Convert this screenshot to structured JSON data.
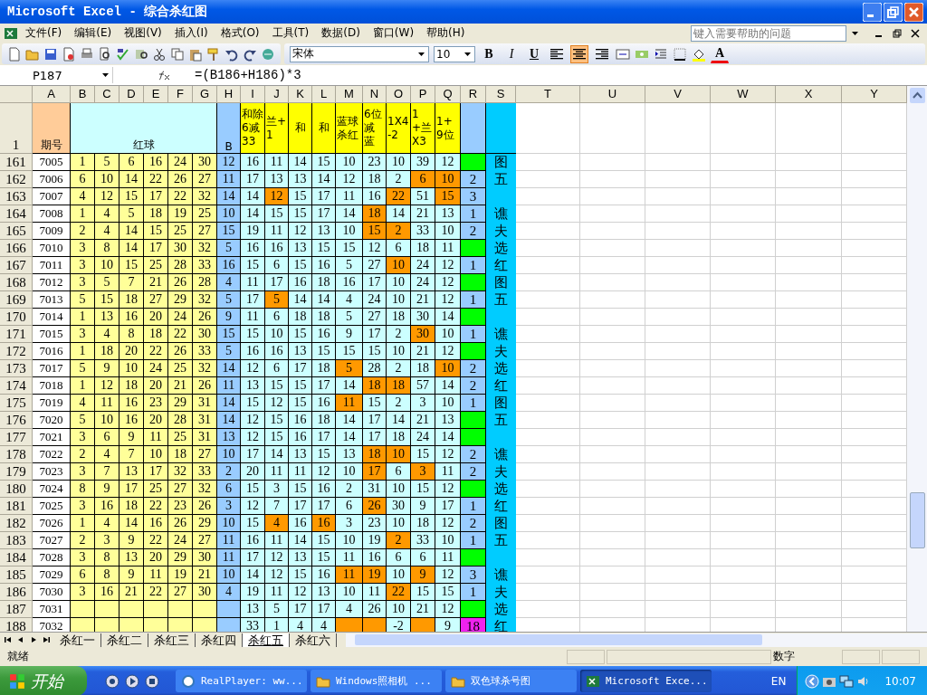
{
  "window": {
    "title": "Microsoft Excel - 综合杀红图"
  },
  "menu": [
    "文件(F)",
    "编辑(E)",
    "视图(V)",
    "插入(I)",
    "格式(O)",
    "工具(T)",
    "数据(D)",
    "窗口(W)",
    "帮助(H)"
  ],
  "help_box": {
    "placeholder": "键入需要帮助的问题"
  },
  "toolbar": {
    "font": "宋体",
    "size": "10",
    "bold": "B",
    "italic": "I",
    "underline": "U",
    "font_color": "A",
    "align_buttons": [
      {
        "kind": "left",
        "selected": false
      },
      {
        "kind": "center",
        "selected": true
      },
      {
        "kind": "right",
        "selected": false
      }
    ]
  },
  "formula_bar": {
    "cell": "P187",
    "formula": "=(B186+H186)*3"
  },
  "columns": [
    "A",
    "B",
    "C",
    "D",
    "E",
    "F",
    "G",
    "H",
    "I",
    "J",
    "K",
    "L",
    "M",
    "N",
    "O",
    "P",
    "Q",
    "R",
    "S",
    "T",
    "U",
    "V",
    "W",
    "X",
    "Y"
  ],
  "header_row": {
    "number": "1",
    "issue": "期号",
    "red": "红球",
    "b": "B",
    "calc": [
      "和除6减33",
      "兰+1",
      "和",
      "和",
      "蓝球杀红",
      "6位减蓝",
      "1X4-2",
      "1+兰X3",
      "1+9位"
    ]
  },
  "rows": [
    {
      "number": "161",
      "issue": "7005",
      "red": [
        "1",
        "5",
        "6",
        "16",
        "24",
        "30"
      ],
      "b": "12",
      "calc": [
        {
          "text": "16",
          "highlighted": false
        },
        {
          "text": "11",
          "highlighted": false
        },
        {
          "text": "14",
          "highlighted": false
        },
        {
          "text": "15",
          "highlighted": false
        },
        {
          "text": "10",
          "highlighted": false
        },
        {
          "text": "23",
          "highlighted": false
        },
        {
          "text": "10",
          "highlighted": false
        },
        {
          "text": "39",
          "highlighted": false
        },
        {
          "text": "12",
          "highlighted": false
        }
      ],
      "r": {
        "color": "#00ff00"
      },
      "s": "图"
    },
    {
      "number": "162",
      "issue": "7006",
      "red": [
        "6",
        "10",
        "14",
        "22",
        "26",
        "27"
      ],
      "b": "11",
      "calc": [
        {
          "text": "17",
          "highlighted": false
        },
        {
          "text": "13",
          "highlighted": false
        },
        {
          "text": "13",
          "highlighted": false
        },
        {
          "text": "14",
          "highlighted": false
        },
        {
          "text": "12",
          "highlighted": false
        },
        {
          "text": "18",
          "highlighted": false
        },
        {
          "text": "2",
          "highlighted": false
        },
        {
          "text": "6",
          "highlighted": true
        },
        {
          "text": "10",
          "highlighted": true
        }
      ],
      "r": {
        "text": "2",
        "color": "#99ccff"
      },
      "s": "五"
    },
    {
      "number": "163",
      "issue": "7007",
      "red": [
        "4",
        "12",
        "15",
        "17",
        "22",
        "32"
      ],
      "b": "14",
      "calc": [
        {
          "text": "14",
          "highlighted": false
        },
        {
          "text": "12",
          "highlighted": true
        },
        {
          "text": "15",
          "highlighted": false
        },
        {
          "text": "17",
          "highlighted": false
        },
        {
          "text": "11",
          "highlighted": false
        },
        {
          "text": "16",
          "highlighted": false
        },
        {
          "text": "22",
          "highlighted": true
        },
        {
          "text": "51",
          "highlighted": false
        },
        {
          "text": "15",
          "highlighted": true
        }
      ],
      "r": {
        "text": "3",
        "color": "#99ccff"
      }
    },
    {
      "number": "164",
      "issue": "7008",
      "red": [
        "1",
        "4",
        "5",
        "18",
        "19",
        "25"
      ],
      "b": "10",
      "calc": [
        {
          "text": "14",
          "highlighted": false
        },
        {
          "text": "15",
          "highlighted": false
        },
        {
          "text": "15",
          "highlighted": false
        },
        {
          "text": "17",
          "highlighted": false
        },
        {
          "text": "14",
          "highlighted": false
        },
        {
          "text": "18",
          "highlighted": true
        },
        {
          "text": "14",
          "highlighted": false
        },
        {
          "text": "21",
          "highlighted": false
        },
        {
          "text": "13",
          "highlighted": false
        }
      ],
      "r": {
        "text": "1",
        "color": "#99ccff"
      },
      "s": "谯"
    },
    {
      "number": "165",
      "issue": "7009",
      "red": [
        "2",
        "4",
        "14",
        "15",
        "25",
        "27"
      ],
      "b": "15",
      "calc": [
        {
          "text": "19",
          "highlighted": false
        },
        {
          "text": "11",
          "highlighted": false
        },
        {
          "text": "12",
          "highlighted": false
        },
        {
          "text": "13",
          "highlighted": false
        },
        {
          "text": "10",
          "highlighted": false
        },
        {
          "text": "15",
          "highlighted": true
        },
        {
          "text": "2",
          "highlighted": true
        },
        {
          "text": "33",
          "highlighted": false
        },
        {
          "text": "10",
          "highlighted": false
        }
      ],
      "r": {
        "text": "2",
        "color": "#99ccff"
      },
      "s": "夫"
    },
    {
      "number": "166",
      "issue": "7010",
      "red": [
        "3",
        "8",
        "14",
        "17",
        "30",
        "32"
      ],
      "b": "5",
      "calc": [
        {
          "text": "16",
          "highlighted": false
        },
        {
          "text": "16",
          "highlighted": false
        },
        {
          "text": "13",
          "highlighted": false
        },
        {
          "text": "15",
          "highlighted": false
        },
        {
          "text": "15",
          "highlighted": false
        },
        {
          "text": "12",
          "highlighted": false
        },
        {
          "text": "6",
          "highlighted": false
        },
        {
          "text": "18",
          "highlighted": false
        },
        {
          "text": "11",
          "highlighted": false
        }
      ],
      "r": {
        "color": "#00ff00"
      },
      "s": "选"
    },
    {
      "number": "167",
      "issue": "7011",
      "red": [
        "3",
        "10",
        "15",
        "25",
        "28",
        "33"
      ],
      "b": "16",
      "calc": [
        {
          "text": "15",
          "highlighted": false
        },
        {
          "text": "6",
          "highlighted": false
        },
        {
          "text": "15",
          "highlighted": false
        },
        {
          "text": "16",
          "highlighted": false
        },
        {
          "text": "5",
          "highlighted": false
        },
        {
          "text": "27",
          "highlighted": false
        },
        {
          "text": "10",
          "highlighted": true
        },
        {
          "text": "24",
          "highlighted": false
        },
        {
          "text": "12",
          "highlighted": false
        }
      ],
      "r": {
        "text": "1",
        "color": "#99ccff"
      },
      "s": "红"
    },
    {
      "number": "168",
      "issue": "7012",
      "red": [
        "3",
        "5",
        "7",
        "21",
        "26",
        "28"
      ],
      "b": "4",
      "calc": [
        {
          "text": "11",
          "highlighted": false
        },
        {
          "text": "17",
          "highlighted": false
        },
        {
          "text": "16",
          "highlighted": false
        },
        {
          "text": "18",
          "highlighted": false
        },
        {
          "text": "16",
          "highlighted": false
        },
        {
          "text": "17",
          "highlighted": false
        },
        {
          "text": "10",
          "highlighted": false
        },
        {
          "text": "24",
          "highlighted": false
        },
        {
          "text": "12",
          "highlighted": false
        }
      ],
      "r": {
        "color": "#00ff00"
      },
      "s": "图"
    },
    {
      "number": "169",
      "issue": "7013",
      "red": [
        "5",
        "15",
        "18",
        "27",
        "29",
        "32"
      ],
      "b": "5",
      "calc": [
        {
          "text": "17",
          "highlighted": false
        },
        {
          "text": "5",
          "highlighted": true
        },
        {
          "text": "14",
          "highlighted": false
        },
        {
          "text": "14",
          "highlighted": false
        },
        {
          "text": "4",
          "highlighted": false
        },
        {
          "text": "24",
          "highlighted": false
        },
        {
          "text": "10",
          "highlighted": false
        },
        {
          "text": "21",
          "highlighted": false
        },
        {
          "text": "12",
          "highlighted": false
        }
      ],
      "r": {
        "text": "1",
        "color": "#99ccff"
      },
      "s": "五"
    },
    {
      "number": "170",
      "issue": "7014",
      "red": [
        "1",
        "13",
        "16",
        "20",
        "24",
        "26"
      ],
      "b": "9",
      "calc": [
        {
          "text": "11",
          "highlighted": false
        },
        {
          "text": "6",
          "highlighted": false
        },
        {
          "text": "18",
          "highlighted": false
        },
        {
          "text": "18",
          "highlighted": false
        },
        {
          "text": "5",
          "highlighted": false
        },
        {
          "text": "27",
          "highlighted": false
        },
        {
          "text": "18",
          "highlighted": false
        },
        {
          "text": "30",
          "highlighted": false
        },
        {
          "text": "14",
          "highlighted": false
        }
      ],
      "r": {
        "color": "#00ff00"
      }
    },
    {
      "number": "171",
      "issue": "7015",
      "red": [
        "3",
        "4",
        "8",
        "18",
        "22",
        "30"
      ],
      "b": "15",
      "calc": [
        {
          "text": "15",
          "highlighted": false
        },
        {
          "text": "10",
          "highlighted": false
        },
        {
          "text": "15",
          "highlighted": false
        },
        {
          "text": "16",
          "highlighted": false
        },
        {
          "text": "9",
          "highlighted": false
        },
        {
          "text": "17",
          "highlighted": false
        },
        {
          "text": "2",
          "highlighted": false
        },
        {
          "text": "30",
          "highlighted": true
        },
        {
          "text": "10",
          "highlighted": false
        }
      ],
      "r": {
        "text": "1",
        "color": "#99ccff"
      },
      "s": "谯"
    },
    {
      "number": "172",
      "issue": "7016",
      "red": [
        "1",
        "18",
        "20",
        "22",
        "26",
        "33"
      ],
      "b": "5",
      "calc": [
        {
          "text": "16",
          "highlighted": false
        },
        {
          "text": "16",
          "highlighted": false
        },
        {
          "text": "13",
          "highlighted": false
        },
        {
          "text": "15",
          "highlighted": false
        },
        {
          "text": "15",
          "highlighted": false
        },
        {
          "text": "15",
          "highlighted": false
        },
        {
          "text": "10",
          "highlighted": false
        },
        {
          "text": "21",
          "highlighted": false
        },
        {
          "text": "12",
          "highlighted": false
        }
      ],
      "r": {
        "color": "#00ff00"
      },
      "s": "夫"
    },
    {
      "number": "173",
      "issue": "7017",
      "red": [
        "5",
        "9",
        "10",
        "24",
        "25",
        "32"
      ],
      "b": "14",
      "calc": [
        {
          "text": "12",
          "highlighted": false
        },
        {
          "text": "6",
          "highlighted": false
        },
        {
          "text": "17",
          "highlighted": false
        },
        {
          "text": "18",
          "highlighted": false
        },
        {
          "text": "5",
          "highlighted": true
        },
        {
          "text": "28",
          "highlighted": false
        },
        {
          "text": "2",
          "highlighted": false
        },
        {
          "text": "18",
          "highlighted": false
        },
        {
          "text": "10",
          "highlighted": true
        }
      ],
      "r": {
        "text": "2",
        "color": "#99ccff"
      },
      "s": "选"
    },
    {
      "number": "174",
      "issue": "7018",
      "red": [
        "1",
        "12",
        "18",
        "20",
        "21",
        "26"
      ],
      "b": "11",
      "calc": [
        {
          "text": "13",
          "highlighted": false
        },
        {
          "text": "15",
          "highlighted": false
        },
        {
          "text": "15",
          "highlighted": false
        },
        {
          "text": "17",
          "highlighted": false
        },
        {
          "text": "14",
          "highlighted": false
        },
        {
          "text": "18",
          "highlighted": true
        },
        {
          "text": "18",
          "highlighted": true
        },
        {
          "text": "57",
          "highlighted": false
        },
        {
          "text": "14",
          "highlighted": false
        }
      ],
      "r": {
        "text": "2",
        "color": "#99ccff"
      },
      "s": "红"
    },
    {
      "number": "175",
      "issue": "7019",
      "red": [
        "4",
        "11",
        "16",
        "23",
        "29",
        "31"
      ],
      "b": "14",
      "calc": [
        {
          "text": "15",
          "highlighted": false
        },
        {
          "text": "12",
          "highlighted": false
        },
        {
          "text": "15",
          "highlighted": false
        },
        {
          "text": "16",
          "highlighted": false
        },
        {
          "text": "11",
          "highlighted": true
        },
        {
          "text": "15",
          "highlighted": false
        },
        {
          "text": "2",
          "highlighted": false
        },
        {
          "text": "3",
          "highlighted": false
        },
        {
          "text": "10",
          "highlighted": false
        }
      ],
      "r": {
        "text": "1",
        "color": "#99ccff"
      },
      "s": "图"
    },
    {
      "number": "176",
      "issue": "7020",
      "red": [
        "5",
        "10",
        "16",
        "20",
        "28",
        "31"
      ],
      "b": "14",
      "calc": [
        {
          "text": "12",
          "highlighted": false
        },
        {
          "text": "15",
          "highlighted": false
        },
        {
          "text": "16",
          "highlighted": false
        },
        {
          "text": "18",
          "highlighted": false
        },
        {
          "text": "14",
          "highlighted": false
        },
        {
          "text": "17",
          "highlighted": false
        },
        {
          "text": "14",
          "highlighted": false
        },
        {
          "text": "21",
          "highlighted": false
        },
        {
          "text": "13",
          "highlighted": false
        }
      ],
      "r": {
        "color": "#00ff00"
      },
      "s": "五"
    },
    {
      "number": "177",
      "issue": "7021",
      "red": [
        "3",
        "6",
        "9",
        "11",
        "25",
        "31"
      ],
      "b": "13",
      "calc": [
        {
          "text": "12",
          "highlighted": false
        },
        {
          "text": "15",
          "highlighted": false
        },
        {
          "text": "16",
          "highlighted": false
        },
        {
          "text": "17",
          "highlighted": false
        },
        {
          "text": "14",
          "highlighted": false
        },
        {
          "text": "17",
          "highlighted": false
        },
        {
          "text": "18",
          "highlighted": false
        },
        {
          "text": "24",
          "highlighted": false
        },
        {
          "text": "14",
          "highlighted": false
        }
      ],
      "r": {
        "color": "#00ff00"
      }
    },
    {
      "number": "178",
      "issue": "7022",
      "red": [
        "2",
        "4",
        "7",
        "10",
        "18",
        "27"
      ],
      "b": "10",
      "calc": [
        {
          "text": "17",
          "highlighted": false
        },
        {
          "text": "14",
          "highlighted": false
        },
        {
          "text": "13",
          "highlighted": false
        },
        {
          "text": "15",
          "highlighted": false
        },
        {
          "text": "13",
          "highlighted": false
        },
        {
          "text": "18",
          "highlighted": true
        },
        {
          "text": "10",
          "highlighted": true
        },
        {
          "text": "15",
          "highlighted": false
        },
        {
          "text": "12",
          "highlighted": false
        }
      ],
      "r": {
        "text": "2",
        "color": "#99ccff"
      },
      "s": "谯"
    },
    {
      "number": "179",
      "issue": "7023",
      "red": [
        "3",
        "7",
        "13",
        "17",
        "32",
        "33"
      ],
      "b": "2",
      "calc": [
        {
          "text": "20",
          "highlighted": false
        },
        {
          "text": "11",
          "highlighted": false
        },
        {
          "text": "11",
          "highlighted": false
        },
        {
          "text": "12",
          "highlighted": false
        },
        {
          "text": "10",
          "highlighted": false
        },
        {
          "text": "17",
          "highlighted": true
        },
        {
          "text": "6",
          "highlighted": false
        },
        {
          "text": "3",
          "highlighted": true
        },
        {
          "text": "11",
          "highlighted": false
        }
      ],
      "r": {
        "text": "2",
        "color": "#99ccff"
      },
      "s": "夫"
    },
    {
      "number": "180",
      "issue": "7024",
      "red": [
        "8",
        "9",
        "17",
        "25",
        "27",
        "32"
      ],
      "b": "6",
      "calc": [
        {
          "text": "15",
          "highlighted": false
        },
        {
          "text": "3",
          "highlighted": false
        },
        {
          "text": "15",
          "highlighted": false
        },
        {
          "text": "16",
          "highlighted": false
        },
        {
          "text": "2",
          "highlighted": false
        },
        {
          "text": "31",
          "highlighted": false
        },
        {
          "text": "10",
          "highlighted": false
        },
        {
          "text": "15",
          "highlighted": false
        },
        {
          "text": "12",
          "highlighted": false
        }
      ],
      "r": {
        "color": "#00ff00"
      },
      "s": "选"
    },
    {
      "number": "181",
      "issue": "7025",
      "red": [
        "3",
        "16",
        "18",
        "22",
        "23",
        "26"
      ],
      "b": "3",
      "calc": [
        {
          "text": "12",
          "highlighted": false
        },
        {
          "text": "7",
          "highlighted": false
        },
        {
          "text": "17",
          "highlighted": false
        },
        {
          "text": "17",
          "highlighted": false
        },
        {
          "text": "6",
          "highlighted": false
        },
        {
          "text": "26",
          "highlighted": true
        },
        {
          "text": "30",
          "highlighted": false
        },
        {
          "text": "9",
          "highlighted": false
        },
        {
          "text": "17",
          "highlighted": false
        }
      ],
      "r": {
        "text": "1",
        "color": "#99ccff"
      },
      "s": "红"
    },
    {
      "number": "182",
      "issue": "7026",
      "red": [
        "1",
        "4",
        "14",
        "16",
        "26",
        "29"
      ],
      "b": "10",
      "calc": [
        {
          "text": "15",
          "highlighted": false
        },
        {
          "text": "4",
          "highlighted": true
        },
        {
          "text": "16",
          "highlighted": false
        },
        {
          "text": "16",
          "highlighted": true
        },
        {
          "text": "3",
          "highlighted": false
        },
        {
          "text": "23",
          "highlighted": false
        },
        {
          "text": "10",
          "highlighted": false
        },
        {
          "text": "18",
          "highlighted": false
        },
        {
          "text": "12",
          "highlighted": false
        }
      ],
      "r": {
        "text": "2",
        "color": "#99ccff"
      },
      "s": "图"
    },
    {
      "number": "183",
      "issue": "7027",
      "red": [
        "2",
        "3",
        "9",
        "22",
        "24",
        "27"
      ],
      "b": "11",
      "calc": [
        {
          "text": "16",
          "highlighted": false
        },
        {
          "text": "11",
          "highlighted": false
        },
        {
          "text": "14",
          "highlighted": false
        },
        {
          "text": "15",
          "highlighted": false
        },
        {
          "text": "10",
          "highlighted": false
        },
        {
          "text": "19",
          "highlighted": false
        },
        {
          "text": "2",
          "highlighted": true
        },
        {
          "text": "33",
          "highlighted": false
        },
        {
          "text": "10",
          "highlighted": false
        }
      ],
      "r": {
        "text": "1",
        "color": "#99ccff"
      },
      "s": "五"
    },
    {
      "number": "184",
      "issue": "7028",
      "red": [
        "3",
        "8",
        "13",
        "20",
        "29",
        "30"
      ],
      "b": "11",
      "calc": [
        {
          "text": "17",
          "highlighted": false
        },
        {
          "text": "12",
          "highlighted": false
        },
        {
          "text": "13",
          "highlighted": false
        },
        {
          "text": "15",
          "highlighted": false
        },
        {
          "text": "11",
          "highlighted": false
        },
        {
          "text": "16",
          "highlighted": false
        },
        {
          "text": "6",
          "highlighted": false
        },
        {
          "text": "6",
          "highlighted": false
        },
        {
          "text": "11",
          "highlighted": false
        }
      ],
      "r": {
        "color": "#00ff00"
      }
    },
    {
      "number": "185",
      "issue": "7029",
      "red": [
        "6",
        "8",
        "9",
        "11",
        "19",
        "21"
      ],
      "b": "10",
      "calc": [
        {
          "text": "14",
          "highlighted": false
        },
        {
          "text": "12",
          "highlighted": false
        },
        {
          "text": "15",
          "highlighted": false
        },
        {
          "text": "16",
          "highlighted": false
        },
        {
          "text": "11",
          "highlighted": true
        },
        {
          "text": "19",
          "highlighted": true
        },
        {
          "text": "10",
          "highlighted": false
        },
        {
          "text": "9",
          "highlighted": true
        },
        {
          "text": "12",
          "highlighted": false
        }
      ],
      "r": {
        "text": "3",
        "color": "#99ccff"
      },
      "s": "谯"
    },
    {
      "number": "186",
      "issue": "7030",
      "red": [
        "3",
        "16",
        "21",
        "22",
        "27",
        "30"
      ],
      "b": "4",
      "calc": [
        {
          "text": "19",
          "highlighted": false
        },
        {
          "text": "11",
          "highlighted": false
        },
        {
          "text": "12",
          "highlighted": false
        },
        {
          "text": "13",
          "highlighted": false
        },
        {
          "text": "10",
          "highlighted": false
        },
        {
          "text": "11",
          "highlighted": false
        },
        {
          "text": "22",
          "highlighted": true
        },
        {
          "text": "15",
          "highlighted": false
        },
        {
          "text": "15",
          "highlighted": false
        }
      ],
      "r": {
        "text": "1",
        "color": "#99ccff"
      },
      "s": "夫"
    },
    {
      "number": "187",
      "issue": "7031",
      "red": [],
      "calc": [
        {
          "text": "13",
          "highlighted": false
        },
        {
          "text": "5",
          "highlighted": false
        },
        {
          "text": "17",
          "highlighted": false
        },
        {
          "text": "17",
          "highlighted": false
        },
        {
          "text": "4",
          "highlighted": false
        },
        {
          "text": "26",
          "highlighted": false
        },
        {
          "text": "10",
          "highlighted": false
        },
        {
          "text": "21",
          "highlighted": false
        },
        {
          "text": "12",
          "highlighted": false
        }
      ],
      "r": {
        "color": "#00ff00"
      },
      "s": "选"
    },
    {
      "number": "188",
      "issue": "7032",
      "red": [],
      "calc": [
        {
          "text": "33",
          "highlighted": false
        },
        {
          "text": "1",
          "highlighted": false
        },
        {
          "text": "4",
          "highlighted": false
        },
        {
          "text": "4",
          "highlighted": false
        },
        {
          "highlighted": true
        },
        {
          "highlighted": true
        },
        {
          "text": "-2",
          "highlighted": false
        },
        {
          "highlighted": true
        },
        {
          "text": "9",
          "highlighted": false
        }
      ],
      "r": {
        "text": "18",
        "color": "#ee22ee"
      },
      "s": "红"
    }
  ],
  "sheet_tabs": [
    {
      "label": "杀红一",
      "selected": false
    },
    {
      "label": "杀红二",
      "selected": false
    },
    {
      "label": "杀红三",
      "selected": false
    },
    {
      "label": "杀红四",
      "selected": false
    },
    {
      "label": "杀红五",
      "selected": true
    },
    {
      "label": "杀红六",
      "selected": false
    }
  ],
  "status_bar": {
    "left": "就绪",
    "mode": "数字"
  },
  "taskbar": {
    "start": "开始",
    "tasks": [
      {
        "label": "RealPlayer: ww...",
        "kind": "app",
        "selected": false
      },
      {
        "label": "Windows照相机 ...",
        "kind": "folder",
        "selected": false
      },
      {
        "label": "双色球杀号图",
        "kind": "folder",
        "selected": false
      },
      {
        "label": "Microsoft Exce...",
        "kind": "excel",
        "selected": true
      }
    ],
    "language": "EN",
    "time": "10:07"
  }
}
